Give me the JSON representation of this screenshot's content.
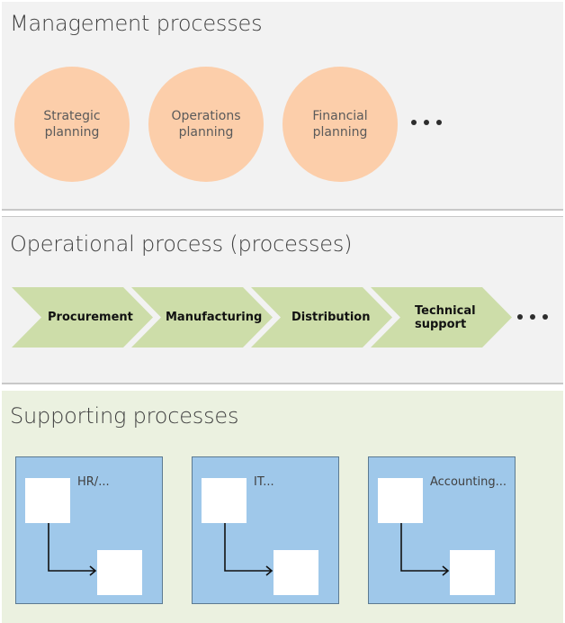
{
  "management": {
    "title": "Management processes",
    "items": [
      {
        "label": "Strategic planning"
      },
      {
        "label": "Operations planning"
      },
      {
        "label": "Financial planning"
      }
    ],
    "more_indicator": "more-items-ellipsis",
    "circle_color": "#fcceaa"
  },
  "operational": {
    "title": "Operational process (processes)",
    "steps": [
      {
        "label": "Procurement"
      },
      {
        "label": "Manufacturing"
      },
      {
        "label": "Distribution"
      },
      {
        "label": "Technical support"
      }
    ],
    "more_indicator": "more-items-ellipsis",
    "chevron_color": "#cddda9"
  },
  "supporting": {
    "title": "Supporting processes",
    "items": [
      {
        "label": "HR/..."
      },
      {
        "label": "IT..."
      },
      {
        "label": "Accounting..."
      }
    ],
    "box_color": "#9fc8ea"
  }
}
